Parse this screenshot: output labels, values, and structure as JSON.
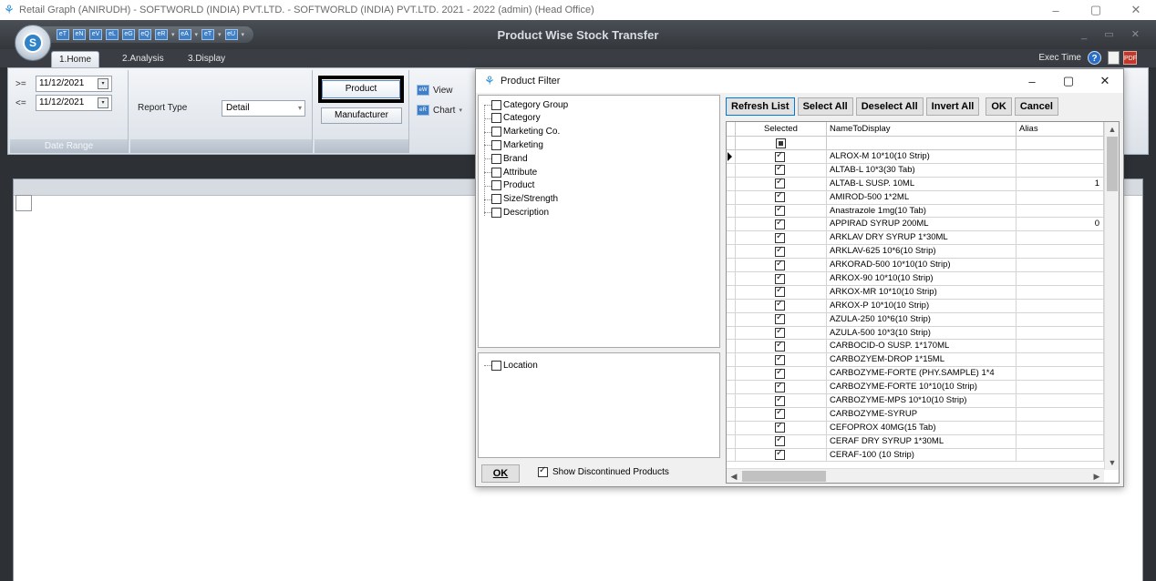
{
  "os_window": {
    "title": "Retail Graph (ANIRUDH) - SOFTWORLD (INDIA) PVT.LTD. - SOFTWORLD (INDIA) PVT.LTD.  2021 - 2022 (admin) (Head Office)",
    "minimize": "–",
    "maximize": "▢",
    "close": "✕"
  },
  "app": {
    "title": "Product Wise Stock Transfer",
    "orb_letter": "S",
    "window_controls": "_ ▭ ✕",
    "qat_buttons": [
      "eT",
      "eN",
      "eV",
      "eL",
      "eG",
      "eQ",
      "eR",
      "eA",
      "eT",
      "eU"
    ],
    "tabs": [
      "1.Home",
      "2.Analysis",
      "3.Display"
    ],
    "exec_time_label": "Exec Time",
    "help": "?"
  },
  "ribbon": {
    "date_range": {
      "from_op": ">=",
      "from_date": "11/12/2021",
      "to_op": "<=",
      "to_date": "11/12/2021",
      "group_label": "Date Range"
    },
    "report_type": {
      "label": "Report Type",
      "value": "Detail"
    },
    "product_label": "Product",
    "manufacturer_label": "Manufacturer",
    "view_label": "View",
    "chart_label": "Chart"
  },
  "dialog": {
    "title": "Product Filter",
    "tree_items": [
      "Category Group",
      "Category",
      "Marketing Co.",
      "Marketing",
      "Brand",
      "Attribute",
      "Product",
      "Size/Strength",
      "Description"
    ],
    "location_item": "Location",
    "ok_label": "OK",
    "show_discontinued_label": "Show Discontinued Products",
    "show_discontinued_checked": true,
    "buttons": {
      "refresh": "Refresh List",
      "select_all": "Select All",
      "deselect_all": "Deselect All",
      "invert_all": "Invert All",
      "ok": "OK",
      "cancel": "Cancel"
    },
    "grid": {
      "columns": [
        "Selected",
        "NameToDisplay",
        "Alias"
      ],
      "rows": [
        {
          "name": "ALROX-M 10*10(10 Strip)",
          "alias": "",
          "selected": true
        },
        {
          "name": "ALTAB-L 10*3(30 Tab)",
          "alias": "",
          "selected": true
        },
        {
          "name": "ALTAB-L SUSP. 10ML",
          "alias": "1",
          "selected": true
        },
        {
          "name": "AMIROD-500 1*2ML",
          "alias": "",
          "selected": true
        },
        {
          "name": "Anastrazole 1mg(10 Tab)",
          "alias": "",
          "selected": true
        },
        {
          "name": "APPIRAD SYRUP 200ML",
          "alias": "0",
          "selected": true
        },
        {
          "name": "ARKLAV DRY SYRUP 1*30ML",
          "alias": "",
          "selected": true
        },
        {
          "name": "ARKLAV-625 10*6(10 Strip)",
          "alias": "",
          "selected": true
        },
        {
          "name": "ARKORAD-500 10*10(10 Strip)",
          "alias": "",
          "selected": true
        },
        {
          "name": "ARKOX-90 10*10(10 Strip)",
          "alias": "",
          "selected": true
        },
        {
          "name": "ARKOX-MR 10*10(10 Strip)",
          "alias": "",
          "selected": true
        },
        {
          "name": "ARKOX-P 10*10(10 Strip)",
          "alias": "",
          "selected": true
        },
        {
          "name": "AZULA-250 10*6(10 Strip)",
          "alias": "",
          "selected": true
        },
        {
          "name": "AZULA-500 10*3(10 Strip)",
          "alias": "",
          "selected": true
        },
        {
          "name": "CARBOCID-O SUSP. 1*170ML",
          "alias": "",
          "selected": true
        },
        {
          "name": "CARBOZYEM-DROP 1*15ML",
          "alias": "",
          "selected": true
        },
        {
          "name": "CARBOZYME-FORTE (PHY.SAMPLE) 1*4",
          "alias": "",
          "selected": true
        },
        {
          "name": "CARBOZYME-FORTE 10*10(10 Strip)",
          "alias": "",
          "selected": true
        },
        {
          "name": "CARBOZYME-MPS 10*10(10 Strip)",
          "alias": "",
          "selected": true
        },
        {
          "name": "CARBOZYME-SYRUP",
          "alias": "",
          "selected": true
        },
        {
          "name": "CEFOPROX 40MG(15 Tab)",
          "alias": "",
          "selected": true
        },
        {
          "name": "CERAF DRY SYRUP 1*30ML",
          "alias": "",
          "selected": true
        },
        {
          "name": "CERAF-100 (10 Strip)",
          "alias": "",
          "selected": true
        }
      ]
    }
  }
}
